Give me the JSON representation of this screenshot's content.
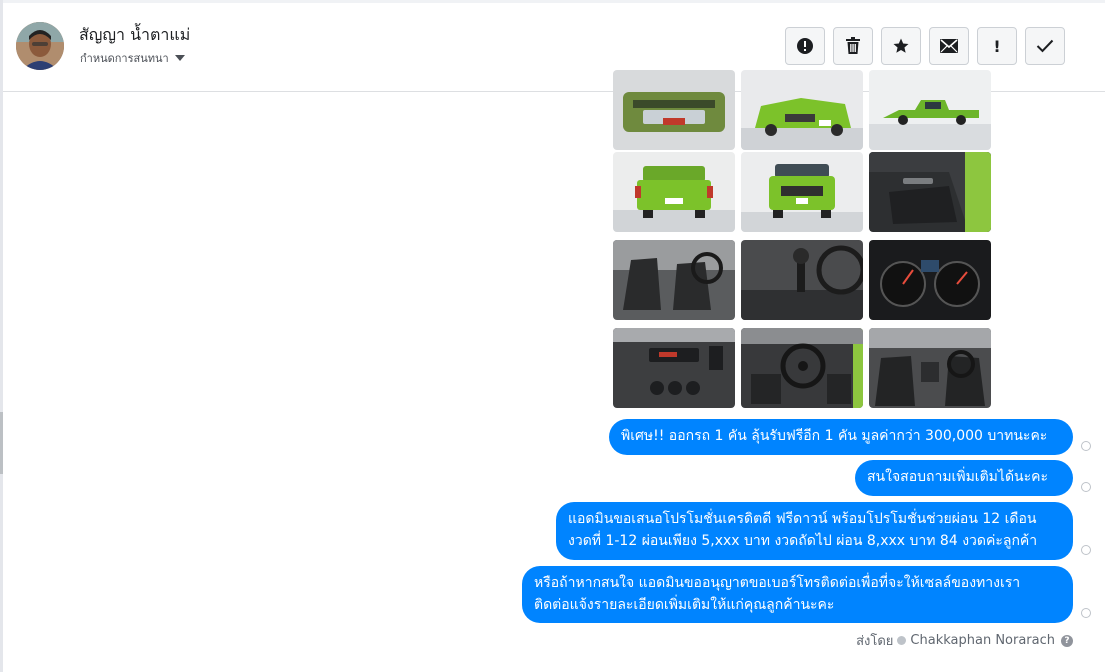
{
  "header": {
    "contact_name": "สัญญา น้ำตาแม่",
    "subtitle": "กำหนดการสนทนา",
    "avatar_icon": "user-avatar",
    "actions": [
      {
        "name": "report-icon",
        "glyph": "exclamation-circle"
      },
      {
        "name": "trash-icon",
        "glyph": "trash"
      },
      {
        "name": "star-icon",
        "glyph": "star"
      },
      {
        "name": "envelope-icon",
        "glyph": "envelope"
      },
      {
        "name": "exclamation-icon",
        "glyph": "!",
        "label": "!"
      },
      {
        "name": "checkmark-icon",
        "glyph": "check"
      }
    ]
  },
  "images": {
    "count": 12,
    "subjects": [
      "open hood engine",
      "green pickup front angle",
      "green pickup side",
      "green pickup rear",
      "green pickup front",
      "door interior panel",
      "front seats",
      "gear shifter",
      "instrument cluster",
      "dashboard console",
      "steering wheel interior",
      "cabin rear view"
    ]
  },
  "messages": [
    {
      "lines": [
        "พิเศษ!! ออกรถ 1 คัน ลุ้นรับฟรีอีก 1 คัน มูลค่ากว่า 300,000 บาทนะคะ"
      ]
    },
    {
      "lines": [
        "สนใจสอบถามเพิ่มเติมได้นะคะ"
      ]
    },
    {
      "lines": [
        "แอดมินขอเสนอโปรโมชั่นเครดิตดี ฟรีดาวน์ พร้อมโปรโมชั่นช่วยผ่อน 12 เดือน",
        "งวดที่ 1-12 ผ่อนเพียง 5,xxx บาท งวดถัดไป ผ่อน 8,xxx บาท 84 งวดค่ะลูกค้า"
      ]
    },
    {
      "lines": [
        "หรือถ้าหากสนใจ แอดมินขออนุญาตขอเบอร์โทรติดต่อเพื่อที่จะให้เซลล์ของทางเรา",
        "ติดต่อแจ้งรายละเอียดเพิ่มเติมให้แก่คุณลูกค้านะคะ"
      ]
    }
  ],
  "footer": {
    "sent_by_label": "ส่งโดย",
    "sender": "Chakkaphan Norarach"
  },
  "colors": {
    "bubble": "#0084ff",
    "car_green": "#7cc22a",
    "interior_dark": "#3a3a3c"
  }
}
